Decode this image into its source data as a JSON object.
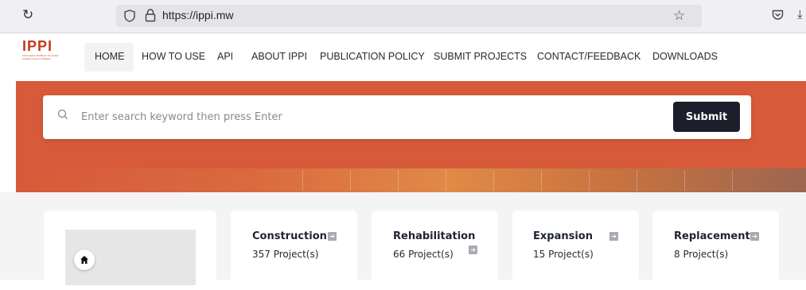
{
  "browser": {
    "url": "https://ippi.mw",
    "icons": [
      "reload-icon",
      "shield-icon",
      "lock-icon",
      "bookmark-star-icon",
      "pocket-icon",
      "download-icon"
    ]
  },
  "logo": {
    "text": "IPPI",
    "tagline": "Information Platform for Public Infrastructure in Malawi"
  },
  "nav": {
    "items": [
      "HOME",
      "HOW TO USE",
      "API",
      "ABOUT IPPI",
      "PUBLICATION POLICY",
      "SUBMIT PROJECTS",
      "CONTACT/FEEDBACK",
      "DOWNLOADS"
    ],
    "active": "HOME"
  },
  "search": {
    "placeholder": "Enter search keyword then press Enter",
    "submit_label": "Submit"
  },
  "categories": [
    {
      "title": "Construction",
      "count": "357 Project(s)"
    },
    {
      "title": "Rehabilitation",
      "count": "66 Project(s)"
    },
    {
      "title": "Expansion",
      "count": "15 Project(s)"
    },
    {
      "title": "Replacement",
      "count": "8 Project(s)"
    }
  ],
  "colors": {
    "hero": "#d75a3a",
    "logo": "#c43a1b",
    "submit_bg": "#1c1f2b",
    "page_bg": "#f4f4f5"
  }
}
